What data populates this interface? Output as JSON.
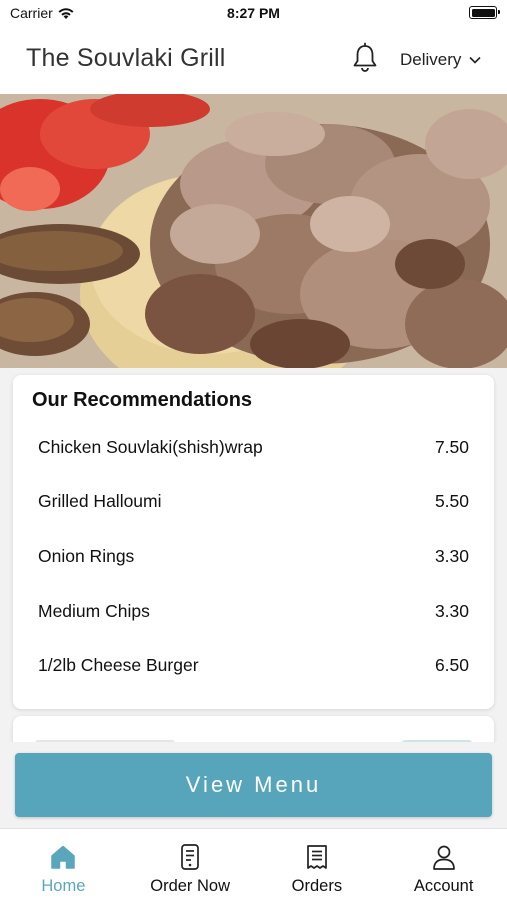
{
  "status_bar": {
    "carrier": "Carrier",
    "time": "8:27 PM"
  },
  "header": {
    "title": "The Souvlaki Grill",
    "delivery_label": "Delivery"
  },
  "recommendations": {
    "heading": "Our Recommendations",
    "items": [
      {
        "name": "Chicken Souvlaki(shish)wrap",
        "price": "7.50"
      },
      {
        "name": "Grilled Halloumi",
        "price": "5.50"
      },
      {
        "name": "Onion Rings",
        "price": "3.30"
      },
      {
        "name": "Medium Chips",
        "price": "3.30"
      },
      {
        "name": "1/2lb Cheese Burger",
        "price": "6.50"
      }
    ]
  },
  "cta": {
    "view_menu": "View Menu"
  },
  "tabbar": {
    "tabs": [
      {
        "label": "Home",
        "icon": "home-icon",
        "active": true
      },
      {
        "label": "Order Now",
        "icon": "order-now-icon",
        "active": false
      },
      {
        "label": "Orders",
        "icon": "orders-icon",
        "active": false
      },
      {
        "label": "Account",
        "icon": "account-icon",
        "active": false
      }
    ]
  },
  "colors": {
    "accent": "#56a5ba",
    "tab_active": "#5aa7bc",
    "background": "#f2f2f2"
  }
}
